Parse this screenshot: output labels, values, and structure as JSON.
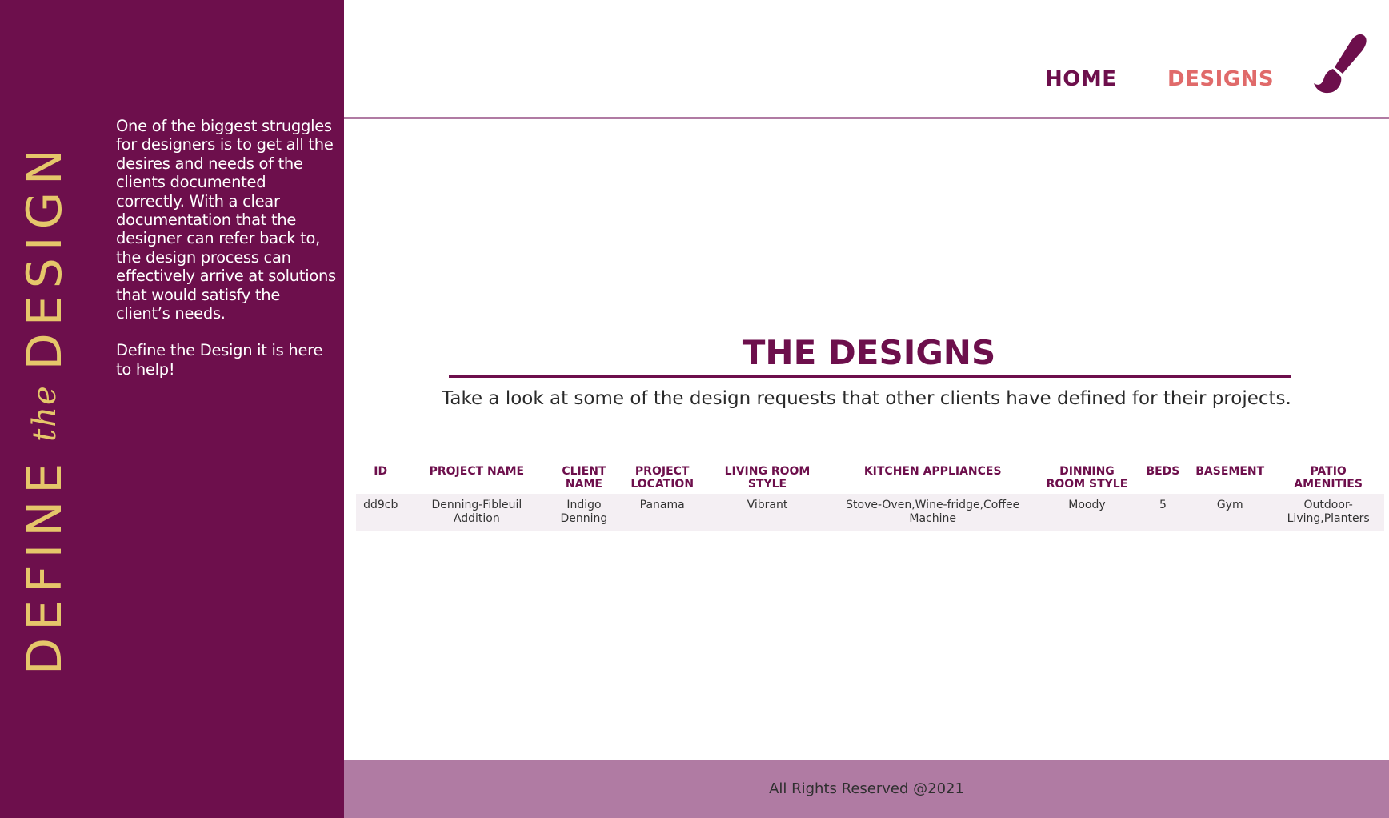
{
  "sidebar": {
    "brand": {
      "word1": "DEFINE",
      "the": "the",
      "word2": "DESIGN"
    },
    "intro_paragraph_1": "One of the biggest struggles for designers is to get all the desires and needs of the clients documented correctly. With a clear documentation that the designer can refer back to, the design process can effectively arrive at solutions that would satisfy the client’s needs.",
    "intro_paragraph_2": "Define the Design it is here to help!"
  },
  "nav": {
    "home": "HOME",
    "designs": "DESIGNS",
    "logo_icon": "paintbrush-icon"
  },
  "main": {
    "title": "THE DESIGNS",
    "subtitle": "Take a look at some of the design requests that other clients have defined for their projects."
  },
  "table": {
    "headers": [
      "ID",
      "PROJECT NAME",
      "CLIENT NAME",
      "PROJECT LOCATION",
      "LIVING ROOM STYLE",
      "KITCHEN APPLIANCES",
      "DINNING ROOM STYLE",
      "BEDS",
      "BASEMENT",
      "PATIO AMENITIES"
    ],
    "rows": [
      [
        "dd9cb",
        "Denning-Fibleuil Addition",
        "Indigo Denning",
        "Panama",
        "Vibrant",
        "Stove-Oven,Wine-fridge,Coffee Machine",
        "Moody",
        "5",
        "Gym",
        "Outdoor-Living,Planters"
      ]
    ]
  },
  "footer": {
    "text": "All Rights Reserved @2021"
  },
  "colors": {
    "sidebar_bg": "#6d0f4c",
    "brand_gold": "#e5c66a",
    "accent_coral": "#e06a6a",
    "footer_bg": "#b07ba3",
    "row_bg": "#f4eff3"
  }
}
